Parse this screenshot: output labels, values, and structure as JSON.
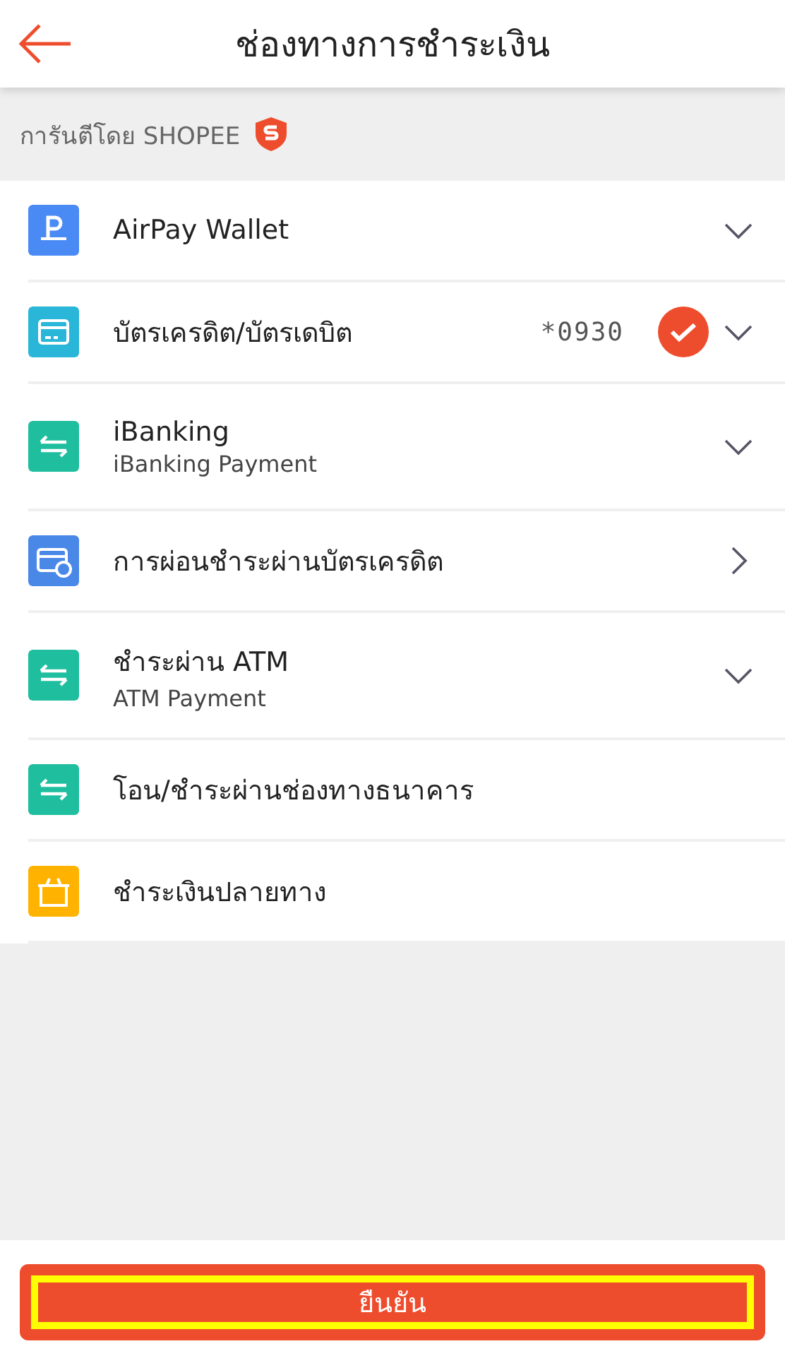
{
  "header": {
    "title": "ช่องทางการชำระเงิน"
  },
  "guarantee": {
    "text": "การันตีโดย SHOPEE"
  },
  "methods": [
    {
      "kind": "wallet",
      "color": "#4a8af4",
      "name": "AirPay Wallet",
      "expandable": true,
      "has_submenu": false,
      "selected": false
    },
    {
      "kind": "card",
      "color": "#29b6d8",
      "name": "บัตรเครดิต/บัตรเดบิต",
      "detail": "*0930",
      "expandable": true,
      "has_submenu": false,
      "selected": true
    },
    {
      "kind": "transfer",
      "color": "#1ebe9e",
      "name": "iBanking",
      "subtitle": "iBanking Payment",
      "expandable": true,
      "has_submenu": false,
      "selected": false
    },
    {
      "kind": "installment",
      "color": "#4a88e8",
      "name": "การผ่อนชำระผ่านบัตรเครดิต",
      "expandable": false,
      "has_submenu": true,
      "selected": false
    },
    {
      "kind": "transfer",
      "color": "#1ebe9e",
      "name": "ชำระผ่าน ATM",
      "subtitle": "ATM Payment",
      "expandable": true,
      "has_submenu": false,
      "selected": false
    },
    {
      "kind": "transfer",
      "color": "#1ebe9e",
      "name": "โอน/ชำระผ่านช่องทางธนาคาร",
      "expandable": false,
      "has_submenu": false,
      "selected": false
    },
    {
      "kind": "cod",
      "color": "#ffb300",
      "name": "ชำระเงินปลายทาง",
      "expandable": false,
      "has_submenu": false,
      "selected": false
    }
  ],
  "confirm_button": {
    "label": "ยืนยัน",
    "highlighted": true
  }
}
